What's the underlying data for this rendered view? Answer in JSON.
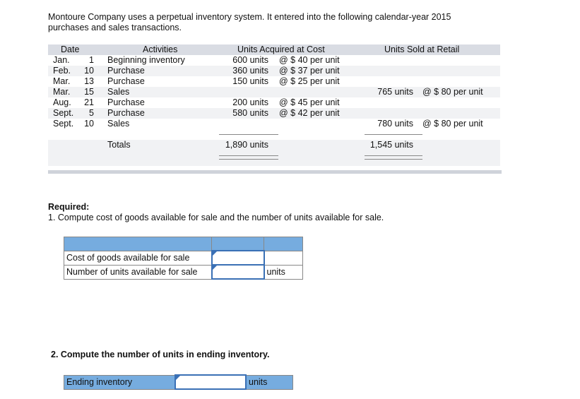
{
  "intro": "Montoure Company uses a perpetual inventory system. It entered into the following calendar-year 2015 purchases and sales transactions.",
  "table": {
    "headers": {
      "date": "Date",
      "activities": "Activities",
      "acquired": "Units Acquired at Cost",
      "sold": "Units Sold at Retail"
    },
    "rows": [
      {
        "month": "Jan.",
        "day": "1",
        "activity": "Beginning inventory",
        "acq_units": "600 units",
        "acq_cost": "@ $ 40 per unit",
        "sold_units": "",
        "sold_price": ""
      },
      {
        "month": "Feb.",
        "day": "10",
        "activity": "Purchase",
        "acq_units": "360 units",
        "acq_cost": "@ $ 37 per unit",
        "sold_units": "",
        "sold_price": ""
      },
      {
        "month": "Mar.",
        "day": "13",
        "activity": "Purchase",
        "acq_units": "150 units",
        "acq_cost": "@ $ 25 per unit",
        "sold_units": "",
        "sold_price": ""
      },
      {
        "month": "Mar.",
        "day": "15",
        "activity": "Sales",
        "acq_units": "",
        "acq_cost": "",
        "sold_units": "765 units",
        "sold_price": "@ $ 80 per unit"
      },
      {
        "month": "Aug.",
        "day": "21",
        "activity": "Purchase",
        "acq_units": "200 units",
        "acq_cost": "@ $ 45 per unit",
        "sold_units": "",
        "sold_price": ""
      },
      {
        "month": "Sept.",
        "day": "5",
        "activity": "Purchase",
        "acq_units": "580 units",
        "acq_cost": "@ $ 42 per unit",
        "sold_units": "",
        "sold_price": ""
      },
      {
        "month": "Sept.",
        "day": "10",
        "activity": "Sales",
        "acq_units": "",
        "acq_cost": "",
        "sold_units": "780 units",
        "sold_price": "@ $ 80 per unit"
      }
    ],
    "totals": {
      "label": "Totals",
      "acquired": "1,890 units",
      "sold": "1,545 units"
    }
  },
  "required": {
    "title": "Required:",
    "q1": "1. Compute cost of goods available for sale and the number of units available for sale.",
    "q2": "2. Compute the number of units in ending inventory."
  },
  "answer1": {
    "row1_label": "Cost of goods available for sale",
    "row2_label": "Number of units available for sale",
    "row2_unit": "units",
    "row1_value": "",
    "row2_value": ""
  },
  "answer2": {
    "label": "Ending inventory",
    "unit": "units",
    "value": ""
  }
}
